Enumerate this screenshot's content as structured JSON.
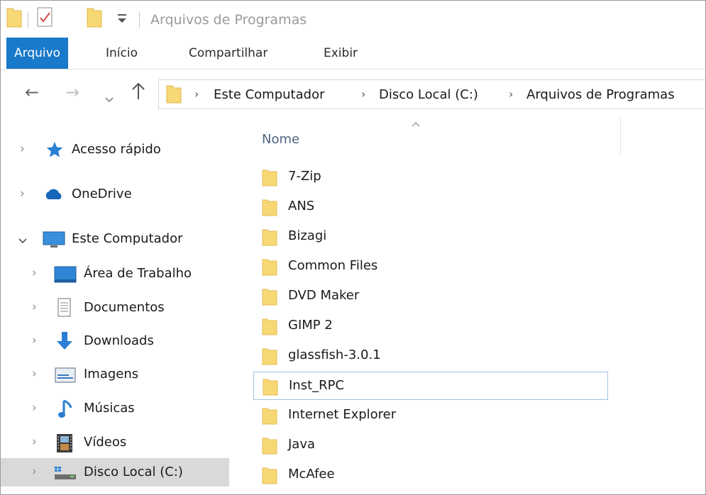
{
  "window": {
    "title": "Arquivos de Programas"
  },
  "ribbon": {
    "tabs": [
      "Arquivo",
      "Início",
      "Compartilhar",
      "Exibir"
    ]
  },
  "address": {
    "crumbs": [
      "Este Computador",
      "Disco Local (C:)",
      "Arquivos de Programas"
    ]
  },
  "nav_pane": {
    "items": [
      {
        "label": "Acesso rápido",
        "icon": "star-icon"
      },
      {
        "label": "OneDrive",
        "icon": "cloud-icon"
      },
      {
        "label": "Este Computador",
        "icon": "computer-icon",
        "expanded": true
      },
      {
        "label": "Área de Trabalho",
        "icon": "desktop-icon"
      },
      {
        "label": "Documentos",
        "icon": "document-icon"
      },
      {
        "label": "Downloads",
        "icon": "download-arrow-icon"
      },
      {
        "label": "Imagens",
        "icon": "image-icon"
      },
      {
        "label": "Músicas",
        "icon": "music-note-icon"
      },
      {
        "label": "Vídeos",
        "icon": "film-icon"
      },
      {
        "label": "Disco Local (C:)",
        "icon": "drive-icon",
        "selected": true
      }
    ]
  },
  "file_list": {
    "column_header": "Nome",
    "focused_item": "Inst_RPC",
    "items": [
      "7-Zip",
      "ANS",
      "Bizagi",
      "Common Files",
      "DVD Maker",
      "GIMP 2",
      "glassfish-3.0.1",
      "Inst_RPC",
      "Internet Explorer",
      "Java",
      "McAfee"
    ]
  },
  "colors": {
    "accent": "#1979ca",
    "folder": "#f8d775",
    "selected_bg": "#d9d9d9",
    "focus_border": "#9fc3e6"
  }
}
